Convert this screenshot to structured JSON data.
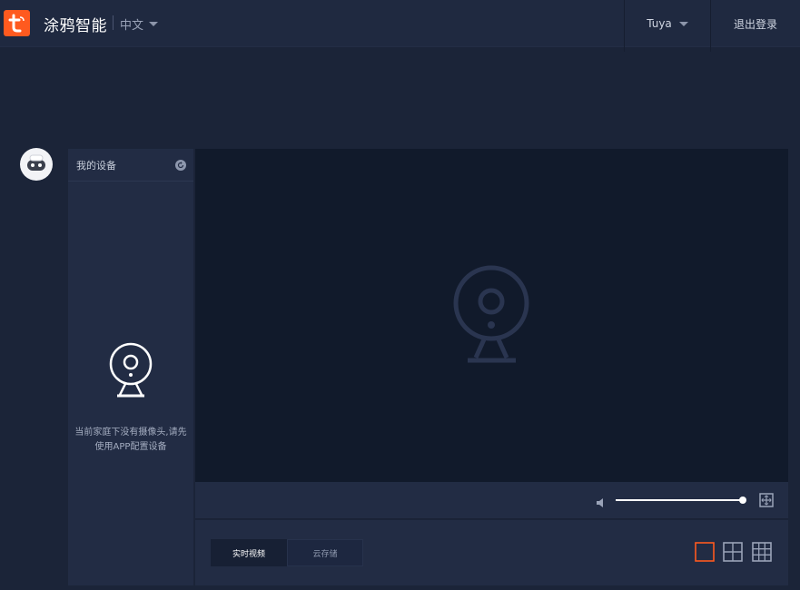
{
  "header": {
    "brand": "涂鸦智能",
    "language": "中文",
    "user": "Tuya",
    "logout_label": "退出登录"
  },
  "sidebar": {
    "title": "我的设备",
    "empty_message": "当前家庭下没有摄像头,请先使用APP配置设备"
  },
  "player": {
    "volume": 1.0
  },
  "tabs": {
    "live": "实时视频",
    "cloud": "云存储"
  },
  "layout_options": [
    "1",
    "4",
    "9"
  ],
  "selected_layout": "1",
  "colors": {
    "accent": "#ff5a1f",
    "background": "#1b2438",
    "panel": "#222c44",
    "viewer": "#111a2b"
  },
  "icons": {
    "logo": "tuya-logo-icon",
    "language": "chevron-down-icon",
    "refresh": "refresh-icon",
    "camera": "camera-icon",
    "volume": "volume-icon",
    "fullscreen": "fullscreen-icon"
  }
}
